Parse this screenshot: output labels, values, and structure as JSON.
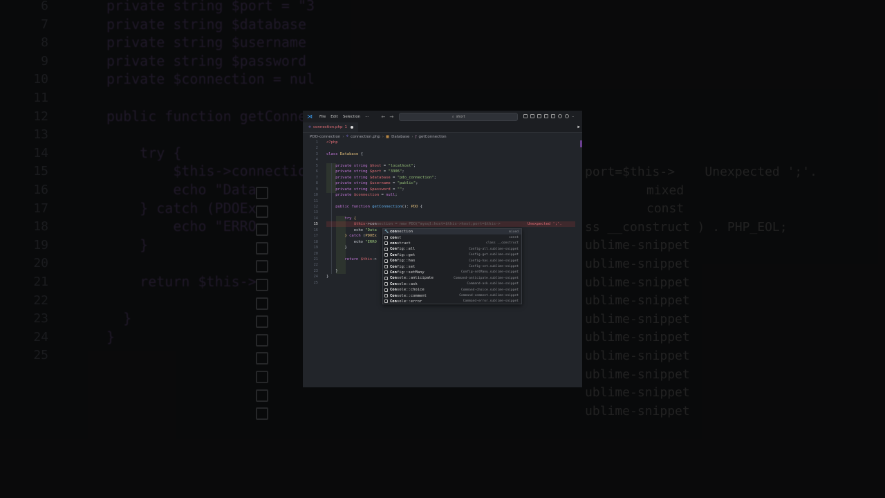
{
  "background": {
    "lines": [
      {
        "num": "6",
        "text": "private string $port = \"3"
      },
      {
        "num": "7",
        "text": "private string $database"
      },
      {
        "num": "8",
        "text": "private string $username"
      },
      {
        "num": "9",
        "text": "private string $password"
      },
      {
        "num": "10",
        "text": "private $connection = nul"
      },
      {
        "num": "11",
        "text": ""
      },
      {
        "num": "12",
        "text": "public function getConnec"
      },
      {
        "num": "13",
        "text": ""
      },
      {
        "num": "14",
        "text": "    try {"
      },
      {
        "num": "15",
        "text": "        $this->connection"
      },
      {
        "num": "16",
        "text": "        echo \"Data"
      },
      {
        "num": "17",
        "text": "    } catch (PDOEx"
      },
      {
        "num": "18",
        "text": "        echo \"ERRO"
      },
      {
        "num": "19",
        "text": "    }"
      },
      {
        "num": "20",
        "text": ""
      },
      {
        "num": "21",
        "text": "    return $this->"
      },
      {
        "num": "22",
        "text": ""
      },
      {
        "num": "23",
        "text": "  }"
      },
      {
        "num": "24",
        "text": "}"
      },
      {
        "num": "25",
        "text": ""
      }
    ],
    "right": [
      {
        "text": "port=$this->    Unexpected ';'."
      },
      {
        "text": "mixed"
      },
      {
        "text": "const"
      },
      {
        "text": "ss __construct ) . PHP_EOL;"
      },
      {
        "text": "ublime-snippet"
      },
      {
        "text": "ublime-snippet"
      },
      {
        "text": "ublime-snippet"
      },
      {
        "text": "ublime-snippet"
      },
      {
        "text": "ublime-snippet"
      },
      {
        "text": "ublime-snippet"
      },
      {
        "text": "ublime-snippet"
      },
      {
        "text": "ublime-snippet"
      },
      {
        "text": "ublime-snippet"
      },
      {
        "text": "ublime-snippet"
      }
    ]
  },
  "titlebar": {
    "menu": [
      "File",
      "Edit",
      "Selection",
      "···"
    ],
    "search_placeholder": "short",
    "search_icon": "search-icon"
  },
  "tab": {
    "filename": "connection.php",
    "modified_count": "1"
  },
  "breadcrumbs": {
    "folder": "PDO-connection",
    "file": "connection.php",
    "class": "Database",
    "method": "getConnection"
  },
  "editor": {
    "line_numbers": [
      "1",
      "2",
      "3",
      "4",
      "5",
      "6",
      "7",
      "8",
      "9",
      "10",
      "11",
      "12",
      "13",
      "14",
      "15",
      "16",
      "17",
      "18",
      "19",
      "20",
      "21",
      "22",
      "23",
      "24",
      "25"
    ],
    "active_line": "15",
    "error_message": "Unexpected ';'."
  },
  "autocomplete": {
    "items": [
      {
        "label_bold": "con",
        "label_rest": "nection",
        "detail": "mixed"
      },
      {
        "label_bold": "con",
        "label_rest": "st",
        "detail": "const"
      },
      {
        "label_bold": "con",
        "label_rest": "struct",
        "detail": "class __construct"
      },
      {
        "label_bold": "Con",
        "label_rest": "fig::all",
        "detail": "Config-all.sublime-snippet"
      },
      {
        "label_bold": "Con",
        "label_rest": "fig::get",
        "detail": "Config-get.sublime-snippet"
      },
      {
        "label_bold": "Con",
        "label_rest": "fig::has",
        "detail": "Config-has.sublime-snippet"
      },
      {
        "label_bold": "Con",
        "label_rest": "fig::set",
        "detail": "Config-set.sublime-snippet"
      },
      {
        "label_bold": "Con",
        "label_rest": "fig::setMany",
        "detail": "Config-setMany.sublime-snippet"
      },
      {
        "label_bold": "Con",
        "label_rest": "sole::anticipate",
        "detail": "Command-anticipate.sublime-snippet"
      },
      {
        "label_bold": "Con",
        "label_rest": "sole::ask",
        "detail": "Command-ask.sublime-snippet"
      },
      {
        "label_bold": "Con",
        "label_rest": "sole::choice",
        "detail": "Command-choice.sublime-snippet"
      },
      {
        "label_bold": "Con",
        "label_rest": "sole::comment",
        "detail": "Command-comment.sublime-snippet"
      },
      {
        "label_bold": "Con",
        "label_rest": "sole::error",
        "detail": "Command-error.sublime-snippet"
      }
    ]
  },
  "colors": {
    "keyword": "#c678dd",
    "variable": "#e06c75",
    "string": "#98c379",
    "function": "#61afef",
    "class": "#e5c07b",
    "editor_bg": "#22252a"
  }
}
